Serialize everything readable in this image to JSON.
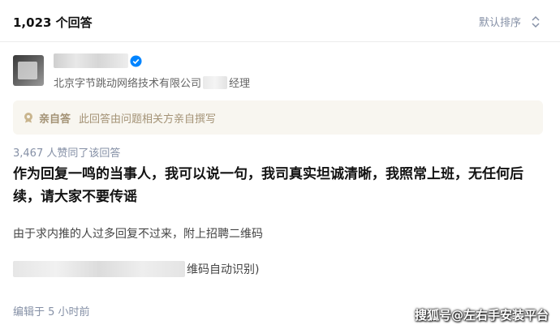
{
  "header": {
    "answer_count": "1,023 个回答",
    "sort_label": "默认排序"
  },
  "author": {
    "title_prefix": "北京字节跳动网络技术有限公司",
    "title_suffix": "经理"
  },
  "banner": {
    "badge": "亲自答",
    "text": "此回答由问题相关方亲自撰写"
  },
  "answer": {
    "votes": "3,467 人赞同了该回答",
    "main_text": "作为回复一鸣的当事人，我可以说一句，我司真实坦诚清晰，我照常上班，无任何后续，请大家不要传谣",
    "sub_text": "由于求内推的人过多回复不过来，附上招聘二维码",
    "qr_suffix": "维码自动识别)",
    "edited": "编辑于 5 小时前"
  },
  "watermark": "搜狐号@左右手安装平台",
  "colors": {
    "banner_bg": "#f8f6f0",
    "banner_text": "#a39275",
    "verified_blue": "#0084ff",
    "meta_gray": "#8590a6"
  }
}
